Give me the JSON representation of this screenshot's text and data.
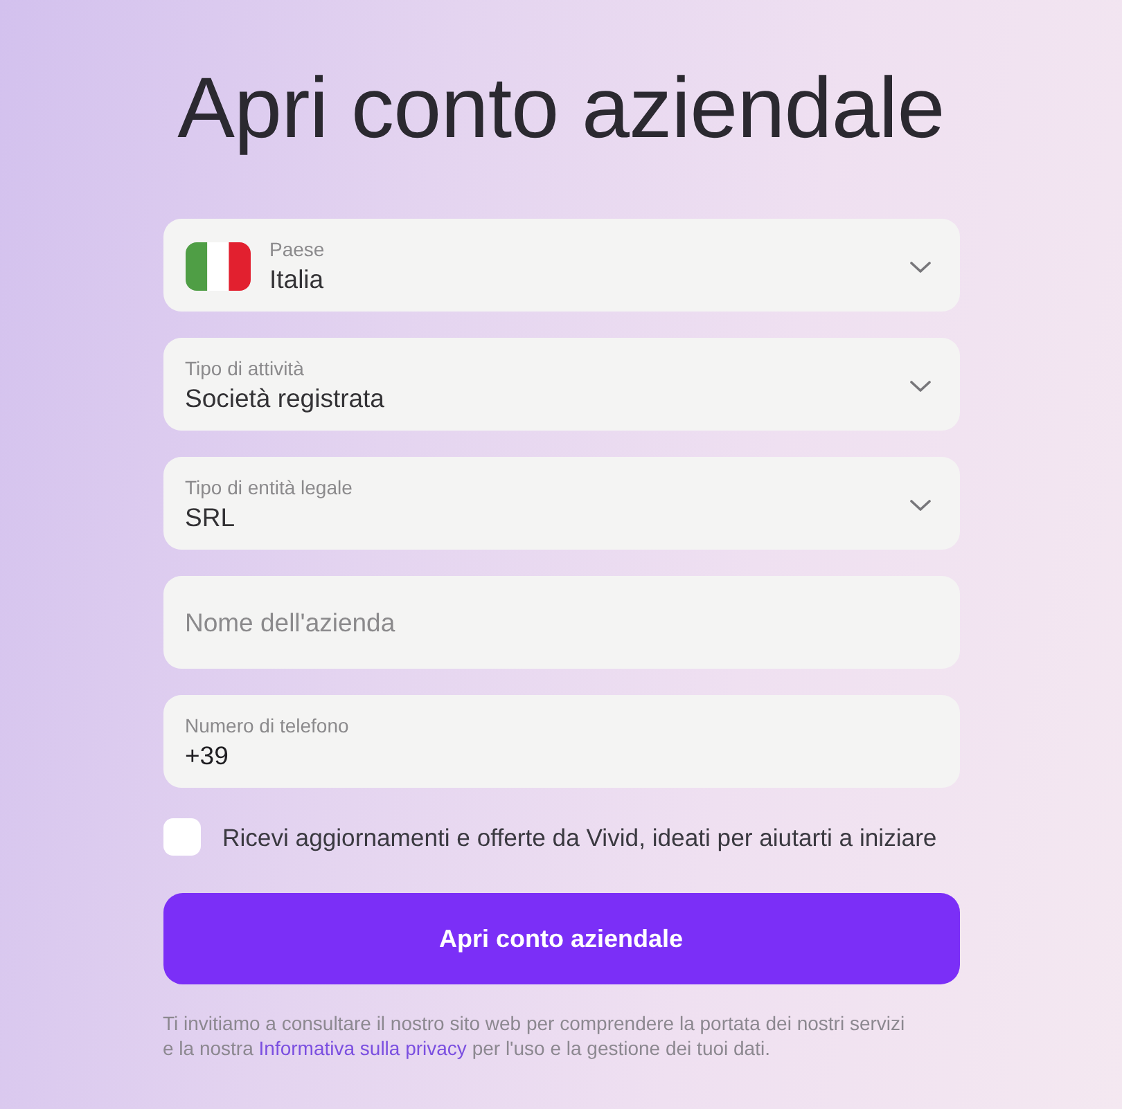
{
  "title": "Apri conto aziendale",
  "fields": [
    {
      "kind": "country-select",
      "label": "Paese",
      "value": "Italia"
    },
    {
      "kind": "select",
      "label": "Tipo di attività",
      "value": "Società registrata"
    },
    {
      "kind": "select",
      "label": "Tipo di entità legale",
      "value": "SRL"
    },
    {
      "kind": "text",
      "placeholder": "Nome dell'azienda"
    },
    {
      "kind": "phone",
      "label": "Numero di telefono",
      "value": "+39"
    }
  ],
  "consent": {
    "label": "Ricevi aggiornamenti e offerte da Vivid, ideati per aiutarti a iniziare",
    "checked": false
  },
  "submit_button": "Apri conto aziendale",
  "footer_notice": {
    "line_1": "Ti invitiamo a consultare il nostro sito web per comprendere la portata dei nostri servizi",
    "line_2_before": "e la nostra ",
    "link": "Informativa sulla privacy",
    "line_2_after": " per l'uso e la gestione dei tuoi dati."
  }
}
